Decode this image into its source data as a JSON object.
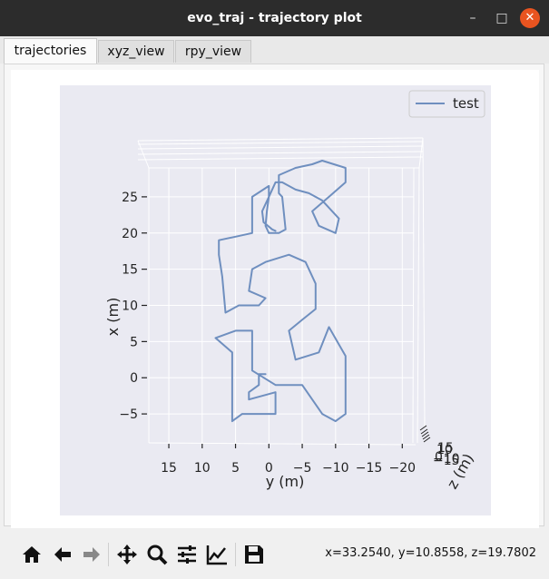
{
  "window": {
    "title": "evo_traj - trajectory plot"
  },
  "tabs": [
    {
      "label": "trajectories",
      "active": true
    },
    {
      "label": "xyz_view",
      "active": false
    },
    {
      "label": "rpy_view",
      "active": false
    }
  ],
  "toolbar": {
    "icons": [
      "home-icon",
      "back-arrow-icon",
      "forward-arrow-icon",
      "pan-icon",
      "zoom-icon",
      "configure-subplots-icon",
      "edit-axis-icon",
      "save-icon"
    ],
    "coordinates": "x=33.2540, y=10.8558, z=19.7802"
  },
  "chart_data": {
    "type": "line",
    "title": "",
    "legend": {
      "entries": [
        "test"
      ],
      "placement": "top-right"
    },
    "xlabel": "y (m)",
    "ylabel": "x (m)",
    "zlabel": "z (m)",
    "x_ticks": [
      "15",
      "10",
      "5",
      "0",
      "−5",
      "−10",
      "−15",
      "−20"
    ],
    "y_ticks": [
      "25",
      "20",
      "15",
      "10",
      "5",
      "0",
      "−5"
    ],
    "z_ticks": [
      "−15",
      "−10",
      "0",
      "10",
      "15"
    ],
    "xlim": [
      18,
      -22
    ],
    "ylim": [
      -9,
      29
    ],
    "grid": true,
    "line_color": "#6f8fbf",
    "series": [
      {
        "name": "test",
        "y_m": [
          0.5,
          1.5,
          1.5,
          3.0,
          3.0,
          -1.0,
          -1.0,
          4.0,
          5.5,
          5.5,
          8.0,
          5.0,
          2.5,
          2.5,
          -1.0,
          -5.0,
          -8.0,
          -10.0,
          -11.5,
          -11.5,
          -9.0,
          -7.5,
          -4.0,
          -3.0,
          -5.0,
          -7.0,
          -7.0,
          -5.5,
          -3.0,
          0.5,
          2.5,
          3.0,
          0.5,
          1.5,
          4.5,
          6.5,
          7.0,
          7.5,
          7.5,
          5.0,
          2.5,
          2.5,
          2.5,
          0.0,
          0.0,
          0.3,
          0.5,
          0.0,
          -1.5,
          -2.5,
          -2.0,
          -1.5,
          -1.5,
          -4.0,
          -6.5,
          -8.0,
          -11.5,
          -11.5,
          -9.0,
          -6.5,
          -7.5,
          -10.0,
          -10.5,
          -8.0,
          -6.0,
          -4.0,
          -2.0,
          -1.0,
          0.0,
          1.0,
          0.8,
          -0.5,
          -1.0
        ],
        "x_m": [
          0.5,
          0.5,
          -1.0,
          -2.0,
          -3.0,
          -2.0,
          -5.0,
          -5.0,
          -6.0,
          3.5,
          5.5,
          6.5,
          6.5,
          1.0,
          -1.0,
          -1.0,
          -5.0,
          -6.0,
          -5.0,
          3.0,
          7.0,
          3.5,
          2.5,
          6.5,
          8.0,
          9.5,
          13.0,
          16.0,
          17.0,
          16.0,
          15.0,
          12.0,
          11.0,
          10.0,
          10.0,
          9.0,
          14.0,
          17.0,
          19.0,
          19.5,
          20.0,
          22.0,
          25.0,
          26.5,
          25.0,
          23.0,
          21.0,
          20.0,
          20.0,
          20.5,
          25.0,
          25.5,
          28.0,
          29.0,
          29.5,
          30.0,
          29.0,
          27.0,
          25.0,
          23.0,
          21.0,
          20.0,
          22.0,
          24.5,
          25.5,
          26.0,
          27.0,
          27.0,
          25.0,
          23.0,
          21.5,
          20.5,
          20.3
        ]
      }
    ]
  }
}
